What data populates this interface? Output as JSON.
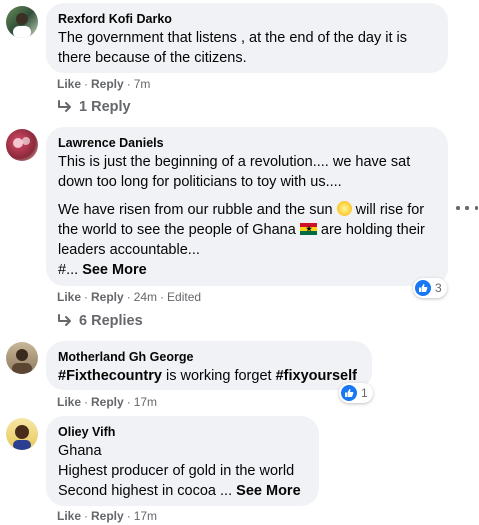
{
  "comments": [
    {
      "author": "Rexford Kofi Darko",
      "paragraphs": [
        "The government that listens , at the end of the day it is there because of the citizens."
      ],
      "like": "Like",
      "reply": "Reply",
      "time": "7m",
      "replies_label": "1 Reply"
    },
    {
      "author": "Lawrence Daniels",
      "p1": "This is just the beginning of a revolution.... we have sat down too long for politicians to toy with us....",
      "p2a": "We have risen from our rubble and the sun",
      "p2b": "will rise for the world to see the people of Ghana",
      "p2c": "are holding their leaders accountable...",
      "p2d": "#...",
      "see_more": "See More",
      "like": "Like",
      "reply": "Reply",
      "time": "24m",
      "edited": "Edited",
      "reactions": "3",
      "replies_label": "6 Replies"
    },
    {
      "author": "Motherland Gh George",
      "hashtag1": "#Fixthecountry",
      "mid": "is working forget",
      "hashtag2": "#fixyourself",
      "like": "Like",
      "reply": "Reply",
      "time": "17m",
      "reactions": "1"
    },
    {
      "author": "Oliey Vifh",
      "line1": "Ghana",
      "line2": "Highest producer of gold in the world",
      "line3": "Second highest in cocoa ...",
      "see_more": "See More",
      "like": "Like",
      "reply": "Reply",
      "time": "17m"
    }
  ],
  "colors": {
    "bubble": "#f0f2f5",
    "meta": "#65676b",
    "like_blue": "#1877f2"
  },
  "icons": {
    "reply_arrow": "reply-arrow-icon",
    "like": "thumbs-up-icon",
    "more": "more-options-icon"
  }
}
